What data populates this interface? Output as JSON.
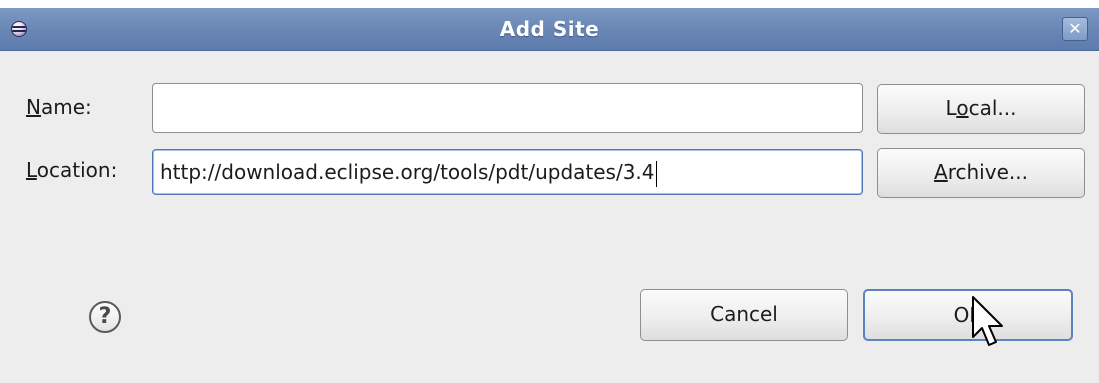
{
  "window": {
    "title": "Add Site",
    "close_glyph": "✕"
  },
  "form": {
    "name": {
      "label_mnemonic": "N",
      "label_rest": "ame:",
      "value": ""
    },
    "location": {
      "label_mnemonic": "L",
      "label_rest": "ocation:",
      "value": "http://download.eclipse.org/tools/pdt/updates/3.4"
    }
  },
  "buttons": {
    "local": {
      "pre": "L",
      "mnemonic": "o",
      "post": "cal..."
    },
    "archive": {
      "pre": "",
      "mnemonic": "A",
      "post": "rchive..."
    },
    "cancel": "Cancel",
    "ok": "OK"
  },
  "help": {
    "glyph": "?"
  },
  "icons": [
    "eclipse-app-icon",
    "close-icon",
    "help-icon",
    "mouse-pointer-icon"
  ],
  "colors": {
    "titlebar": "#6a87b6",
    "dialog_bg": "#ededed",
    "focus_border": "#4e76b8"
  }
}
